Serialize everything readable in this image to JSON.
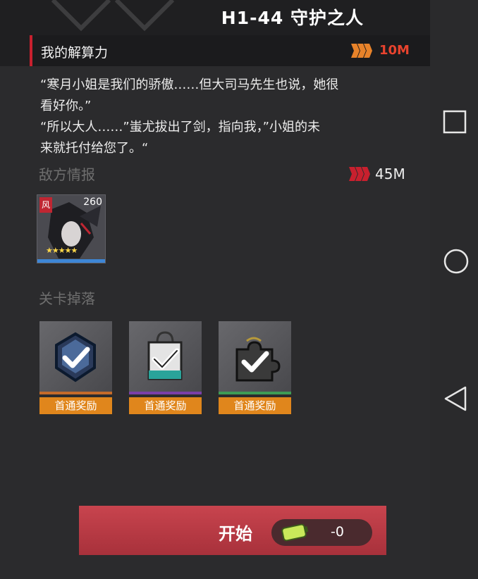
{
  "stage": {
    "title": "H1-44  守护之人"
  },
  "calc": {
    "label": "我的解算力",
    "value": "10M",
    "icon": "calc-stripes-icon",
    "color": "#e8432e"
  },
  "story": {
    "lines": [
      "“寒月小姐是我们的骄傲……但大司马先生也说，她很",
      "看好你。”",
      "“所以大人……”蚩尤拔出了剑，指向我，”小姐的未",
      "来就托付给您了。“"
    ]
  },
  "enemy": {
    "title": "敌方情报",
    "power": "45M",
    "icon": "power-stripes-icon",
    "card": {
      "badge": "风",
      "level": "260",
      "stars": "★★★★★"
    }
  },
  "drops": {
    "title": "关卡掉落",
    "items": [
      {
        "name": "blue-crystal",
        "label": "首通奖励",
        "stripe": "#c46b2a",
        "icon": "crystal-icon"
      },
      {
        "name": "shopping-bag",
        "label": "首通奖励",
        "stripe": "#7a3fa8",
        "icon": "bag-icon"
      },
      {
        "name": "puzzle-piece",
        "label": "首通奖励",
        "stripe": "#3e9b55",
        "icon": "puzzle-icon"
      }
    ]
  },
  "start": {
    "label": "开始",
    "cost": "-0",
    "cost_icon": "battery-icon"
  },
  "nav": {
    "square": "recent-apps-icon",
    "circle": "home-icon",
    "triangle": "back-icon"
  }
}
